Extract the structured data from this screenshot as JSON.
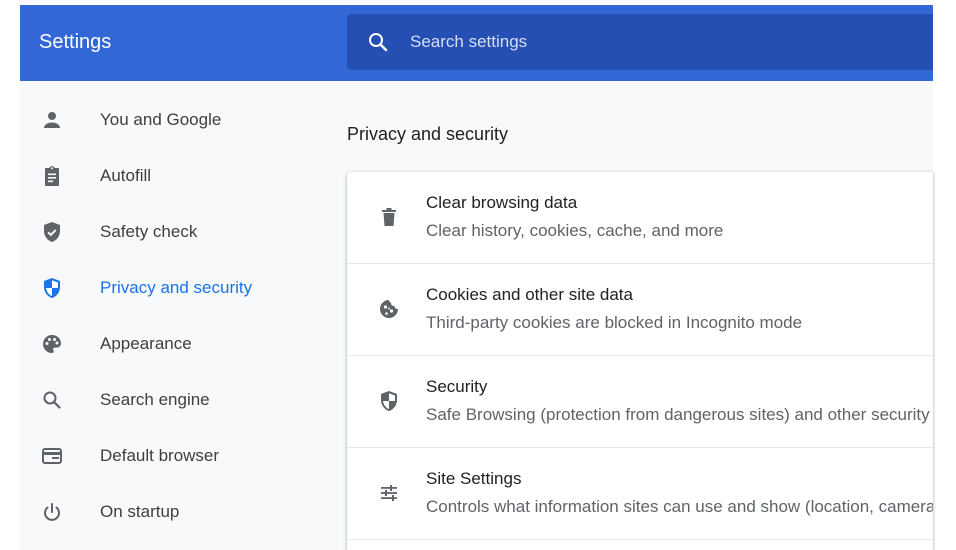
{
  "header": {
    "title": "Settings",
    "search_placeholder": "Search settings",
    "search_value": ""
  },
  "sidebar": {
    "items": [
      {
        "label": "You and Google",
        "icon": "person-icon"
      },
      {
        "label": "Autofill",
        "icon": "clipboard-icon"
      },
      {
        "label": "Safety check",
        "icon": "shield-check-icon"
      },
      {
        "label": "Privacy and security",
        "icon": "shield-half-icon",
        "active": true
      },
      {
        "label": "Appearance",
        "icon": "palette-icon"
      },
      {
        "label": "Search engine",
        "icon": "search-icon"
      },
      {
        "label": "Default browser",
        "icon": "browser-window-icon"
      },
      {
        "label": "On startup",
        "icon": "power-icon"
      }
    ]
  },
  "main": {
    "section_title": "Privacy and security",
    "rows": [
      {
        "title": "Clear browsing data",
        "subtitle": "Clear history, cookies, cache, and more",
        "icon": "trash-icon"
      },
      {
        "title": "Cookies and other site data",
        "subtitle": "Third-party cookies are blocked in Incognito mode",
        "icon": "cookie-icon"
      },
      {
        "title": "Security",
        "subtitle": "Safe Browsing (protection from dangerous sites) and other security settings",
        "icon": "shield-icon"
      },
      {
        "title": "Site Settings",
        "subtitle": "Controls what information sites can use and show (location, camera, pop-ups, and more)",
        "icon": "tune-icon"
      }
    ]
  },
  "colors": {
    "header_bg": "#3367d6",
    "search_bg": "#254fb3",
    "accent": "#1a73e8",
    "page_bg": "#f8f9fa",
    "icon_gray": "#5f6368"
  }
}
